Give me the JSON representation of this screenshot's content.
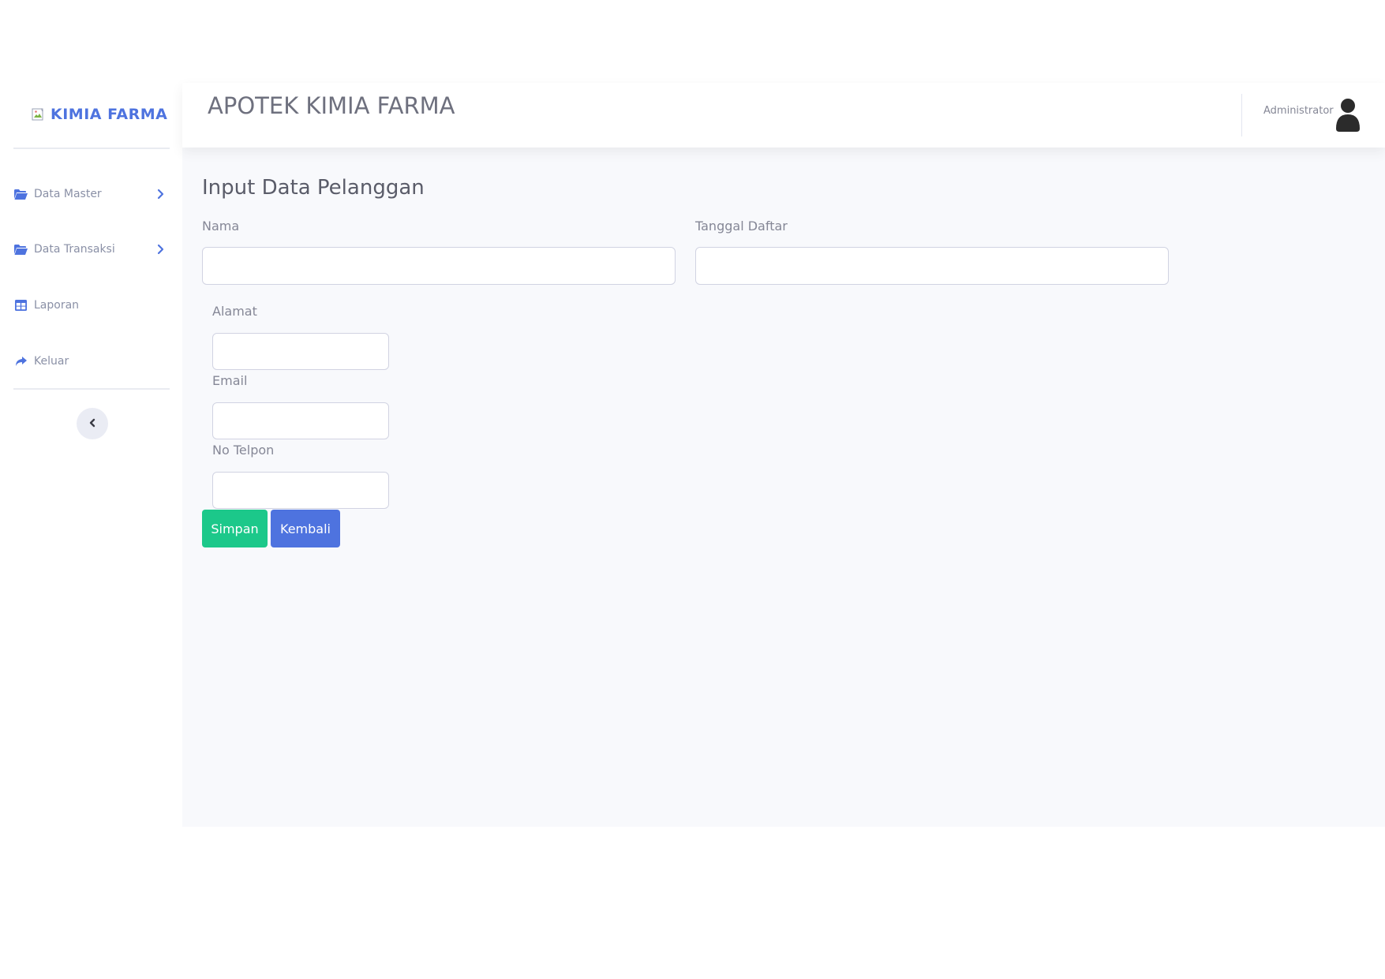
{
  "sidebar": {
    "brand": "KIMIA FARMA",
    "brand_icon": "broken-image-icon",
    "items": [
      {
        "label": "Data Master",
        "icon": "folder-icon",
        "has_submenu": true
      },
      {
        "label": "Data Transaksi",
        "icon": "folder-icon",
        "has_submenu": true
      },
      {
        "label": "Laporan",
        "icon": "table-icon",
        "has_submenu": false
      },
      {
        "label": "Keluar",
        "icon": "share-arrow-icon",
        "has_submenu": false
      }
    ],
    "toggle_icon": "chevron-left-icon"
  },
  "topbar": {
    "title": "APOTEK KIMIA FARMA",
    "user_name": "Administrator",
    "avatar_icon": "user-icon"
  },
  "form": {
    "title": "Input Data Pelanggan",
    "fields": {
      "nama": {
        "label": "Nama",
        "value": ""
      },
      "tanggal_daftar": {
        "label": "Tanggal Daftar",
        "value": ""
      },
      "alamat": {
        "label": "Alamat",
        "value": ""
      },
      "email": {
        "label": "Email",
        "value": ""
      },
      "no_telpon": {
        "label": "No Telpon",
        "value": ""
      }
    },
    "buttons": {
      "save": "Simpan",
      "back": "Kembali"
    }
  },
  "colors": {
    "primary": "#4e73df",
    "success": "#1cc88a",
    "content_bg": "#f8f9fc",
    "muted_text": "#858796"
  }
}
